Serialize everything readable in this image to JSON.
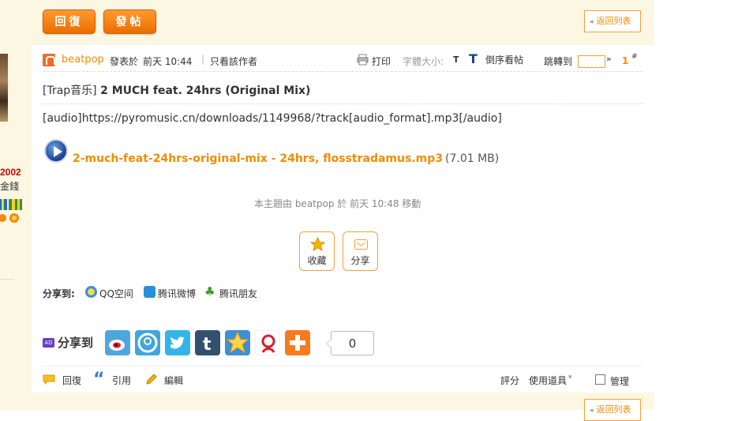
{
  "sidebar": {
    "year": "2002",
    "level": "金錢"
  },
  "toolbar": {
    "reply": "回復",
    "post": "發帖",
    "back_to_list": "返回列表"
  },
  "post_header": {
    "author": "beatpop",
    "posted_at_label": "發表於",
    "posted_time": "前天 10:44",
    "separator": "|",
    "only_author": "只看該作者",
    "print": "打印",
    "font_size_label": "字體大小:",
    "font_small": "T",
    "font_large": "T",
    "reverse_order": "倒序看帖",
    "jump_to": "跳轉到",
    "jump_arrow": "»",
    "floor": "1",
    "floor_mark": "#"
  },
  "post": {
    "category": "[Trap音乐]",
    "title": "2 MUCH feat. 24hrs (Original Mix)",
    "audio_code": "[audio]https://pyromusic.cn/downloads/1149968/?track[audio_format].mp3[/audio]",
    "file_link": "2-much-feat-24hrs-original-mix - 24hrs, flosstradamus.mp3",
    "file_size": "(7.01 MB)",
    "moved_note": "本主題由 beatpop 於 前天 10:48 移動"
  },
  "actions": {
    "favorite": "收藏",
    "share": "分享"
  },
  "share_to": {
    "label": "分享到:",
    "targets": [
      "QQ空间",
      "腾讯微博",
      "腾讯朋友"
    ]
  },
  "share_bar": {
    "ad_badge": "AD",
    "label": "分享到",
    "count": "0"
  },
  "footer": {
    "reply": "回復",
    "quote": "引用",
    "edit": "編輯",
    "rate": "評分",
    "use_tool": "使用道具",
    "manage": "管理",
    "back_to_list": "返回列表"
  },
  "colors": {
    "accent": "#f28c00",
    "bg_beige": "#fbf7e3",
    "year_red": "#cc0000"
  },
  "icons": [
    "user-icon",
    "print-icon",
    "play-icon",
    "star-icon",
    "envelope-icon",
    "qzone-icon",
    "tencent-weibo-icon",
    "pengyou-icon",
    "sina-weibo-icon",
    "plus-icon",
    "reply-icon",
    "quote-icon",
    "pencil-icon"
  ]
}
